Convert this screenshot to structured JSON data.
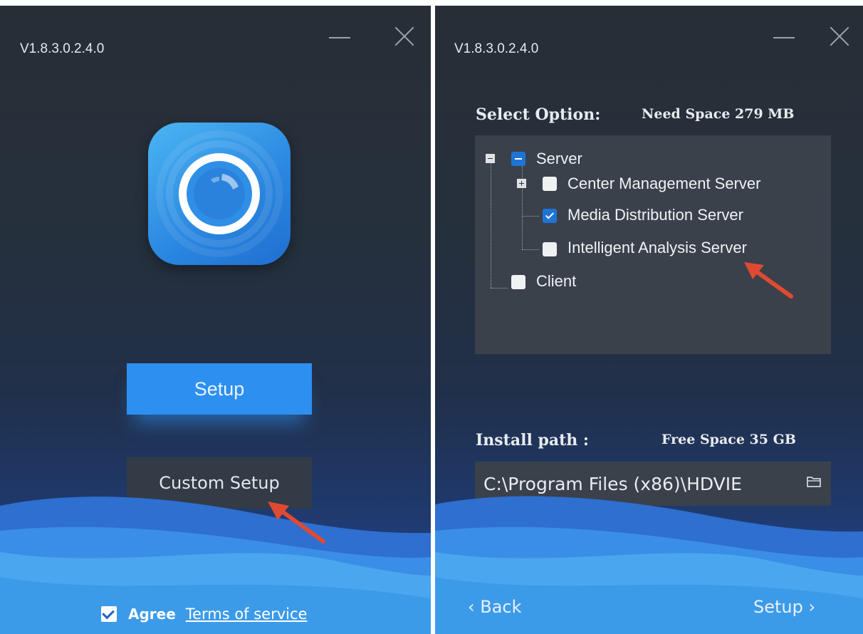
{
  "colors": {
    "accent": "#2d8ff0",
    "annotation_arrow": "#e04a32",
    "checkbox_blue": "#1e74d6"
  },
  "left_window": {
    "version": "V1.8.3.0.2.4.0",
    "minimize_icon": "minimize-icon",
    "close_icon": "close-icon",
    "setup_label": "Setup",
    "custom_setup_label": "Custom Setup",
    "agree_label": "Agree",
    "agree_checked": true,
    "terms_label": "Terms of service"
  },
  "right_window": {
    "version": "V1.8.3.0.2.4.0",
    "select_option_label": "Select Option:",
    "need_space_label": "Need Space 279 MB",
    "tree": {
      "server_label": "Server",
      "server_state": "partial",
      "children": [
        {
          "label": "Center Management Server",
          "checked": false,
          "expandable": true
        },
        {
          "label": "Media Distribution Server",
          "checked": true,
          "expandable": false
        },
        {
          "label": "Intelligent Analysis Server",
          "checked": false,
          "expandable": false
        }
      ],
      "client_label": "Client",
      "client_checked": false
    },
    "install_path_label": "Install path :",
    "free_space_label": "Free Space 35 GB",
    "install_path_value": "C:\\Program Files (x86)\\HDVIE",
    "back_label": "‹ Back",
    "setup_label": "Setup ›"
  }
}
